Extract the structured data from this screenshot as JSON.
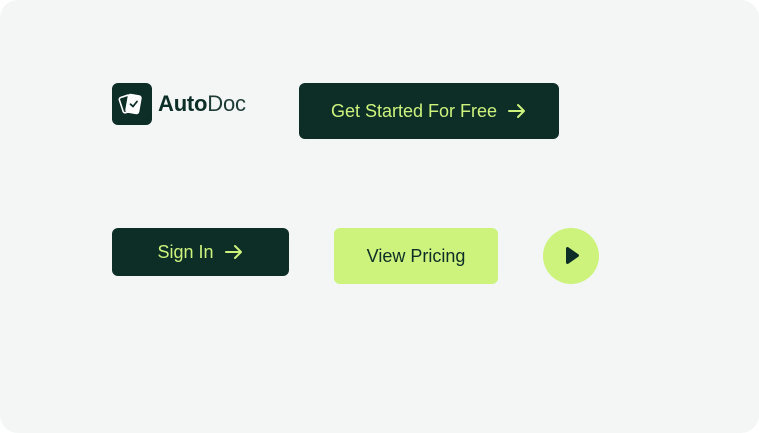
{
  "brand": {
    "name_part1": "Auto",
    "name_part2": "Doc",
    "icon": "cards-check-icon"
  },
  "buttons": {
    "get_started": {
      "label": "Get Started For Free",
      "icon": "arrow-right-icon"
    },
    "sign_in": {
      "label": "Sign In",
      "icon": "arrow-right-icon"
    },
    "view_pricing": {
      "label": "View Pricing"
    },
    "play": {
      "icon": "play-icon"
    }
  },
  "colors": {
    "dark": "#0d2e27",
    "lime": "#cdf37d",
    "background": "#f3f6f5"
  }
}
